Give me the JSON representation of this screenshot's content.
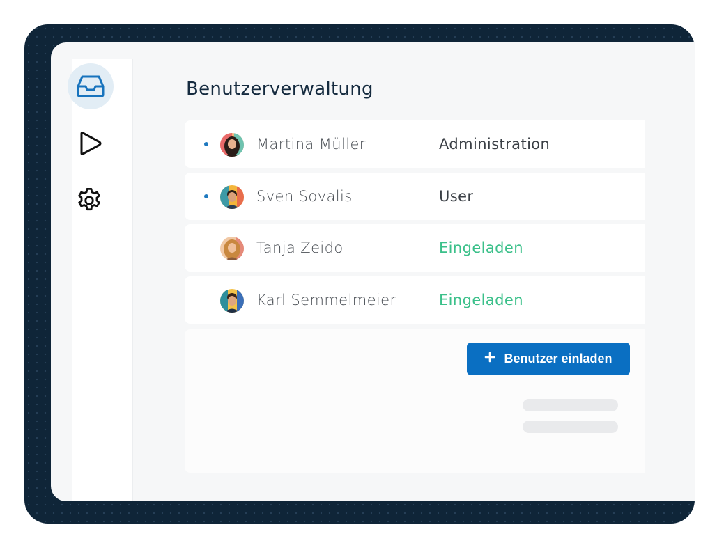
{
  "sidebar": {
    "items": [
      {
        "icon": "inbox-icon",
        "active": true
      },
      {
        "icon": "play-icon",
        "active": false
      },
      {
        "icon": "gear-icon",
        "active": false
      }
    ]
  },
  "page": {
    "title": "Benutzerverwaltung"
  },
  "users": [
    {
      "name": "Martina Müller",
      "role": "Administration",
      "status_dot": true,
      "invited": false
    },
    {
      "name": "Sven Sovalis",
      "role": "User",
      "status_dot": true,
      "invited": false
    },
    {
      "name": "Tanja Zeido",
      "role": "Eingeladen",
      "status_dot": false,
      "invited": true
    },
    {
      "name": "Karl Semmelmeier",
      "role": "Eingeladen",
      "status_dot": false,
      "invited": true
    }
  ],
  "actions": {
    "invite_label": "Benutzer einladen"
  },
  "colors": {
    "accent": "#0a6fc2",
    "invited": "#3bc08a",
    "dot": "#1f79bf",
    "frame": "#0f2538"
  }
}
